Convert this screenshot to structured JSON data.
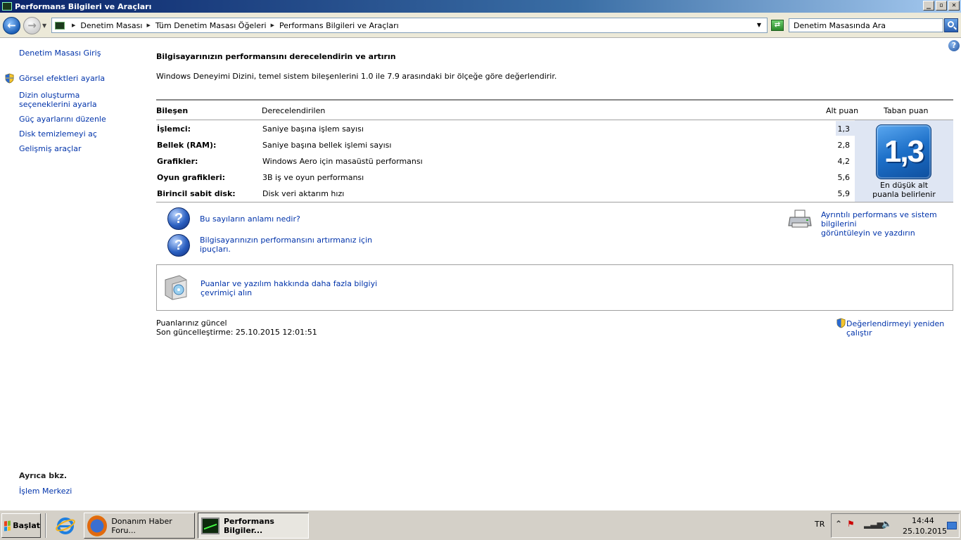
{
  "window": {
    "title": "Performans Bilgileri ve Araçları",
    "controls": {
      "minimize": "_",
      "maximize": "▫",
      "close": "✕"
    }
  },
  "address": {
    "crumbs": [
      "Denetim Masası",
      "Tüm Denetim Masası Öğeleri",
      "Performans Bilgileri ve Araçları"
    ],
    "search_placeholder": "Denetim Masasında Ara"
  },
  "sidebar": {
    "home": "Denetim Masası Giriş",
    "items": [
      "Görsel efektleri ayarla",
      "Dizin oluşturma seçeneklerini ayarla",
      "Güç ayarlarını düzenle",
      "Disk temizlemeyi aç",
      "Gelişmiş araçlar"
    ],
    "see_also_title": "Ayrıca bkz.",
    "see_also_items": [
      "İşlem Merkezi"
    ]
  },
  "main": {
    "title": "Bilgisayarınızın performansını derecelendirin ve artırın",
    "description": "Windows Deneyimi Dizini, temel sistem bileşenlerini 1.0 ile 7.9 arasındaki bir ölçeğe göre değerlendirir.",
    "table": {
      "headers": {
        "component": "Bileşen",
        "rated": "Derecelendirilen",
        "subscore": "Alt puan",
        "base": "Taban puan"
      },
      "rows": [
        {
          "component": "İşlemci:",
          "rated": "Saniye başına işlem sayısı",
          "score": "1,3"
        },
        {
          "component": "Bellek (RAM):",
          "rated": "Saniye başına bellek işlemi sayısı",
          "score": "2,8"
        },
        {
          "component": "Grafikler:",
          "rated": "Windows Aero için masaüstü performansı",
          "score": "4,2"
        },
        {
          "component": "Oyun grafikleri:",
          "rated": "3B iş ve oyun performansı",
          "score": "5,6"
        },
        {
          "component": "Birincil sabit disk:",
          "rated": "Disk veri aktarım hızı",
          "score": "5,9"
        }
      ],
      "base_score": "1,3",
      "base_caption_line1": "En düşük alt",
      "base_caption_line2": "puanla belirlenir"
    },
    "links": {
      "meaning": "Bu sayıların anlamı nedir?",
      "tips_line1": "Bilgisayarınızın performansını artırmanız için",
      "tips_line2": "ipuçları.",
      "detail_line1": "Ayrıntılı performans ve sistem bilgilerini",
      "detail_line2": "görüntüleyin ve yazdırın",
      "online_line1": "Puanlar ve yazılım hakkında daha fazla bilgiyi",
      "online_line2": "çevrimiçi alın",
      "rerun": "Değerlendirmeyi yeniden çalıştır"
    },
    "status": {
      "line1": "Puanlarınız güncel",
      "line2": "Son güncelleştirme: 25.10.2015 12:01:51"
    }
  },
  "taskbar": {
    "start_label": "Başlat",
    "tasks": [
      {
        "label": "Donanım Haber Foru...",
        "icon": "firefox-icon"
      },
      {
        "label": "Performans Bilgiler...",
        "icon": "performance-monitor-icon"
      }
    ],
    "language": "TR",
    "clock_time": "14:44",
    "clock_date": "25.10.2015"
  },
  "colors": {
    "link": "#0033aa",
    "accent_blue": "#1c6fc8",
    "title_bar": "#0a246a"
  }
}
